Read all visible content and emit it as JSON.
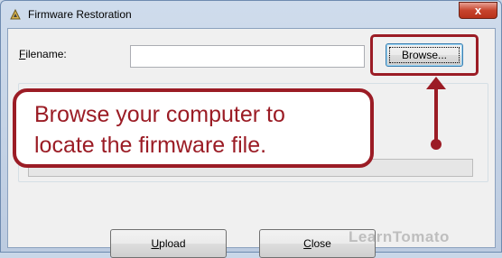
{
  "window": {
    "title": "Firmware Restoration",
    "close_glyph": "x"
  },
  "form": {
    "filename_label_underlined": "F",
    "filename_label_rest": "ilename:",
    "filename_value": "",
    "browse_label": "Browse...",
    "upload_label_underlined": "U",
    "upload_label_rest": "pload",
    "close_label_underlined": "C",
    "close_label_rest": "lose"
  },
  "annotation": {
    "line1": "Browse your computer to",
    "line2": "locate the firmware file."
  },
  "watermark": "LearnTomato",
  "colors": {
    "annotation": "#9b1c25",
    "close_button": "#c7442d"
  },
  "icons": {
    "app": "firmware-app-icon",
    "arrow": "arrow-up-icon"
  }
}
